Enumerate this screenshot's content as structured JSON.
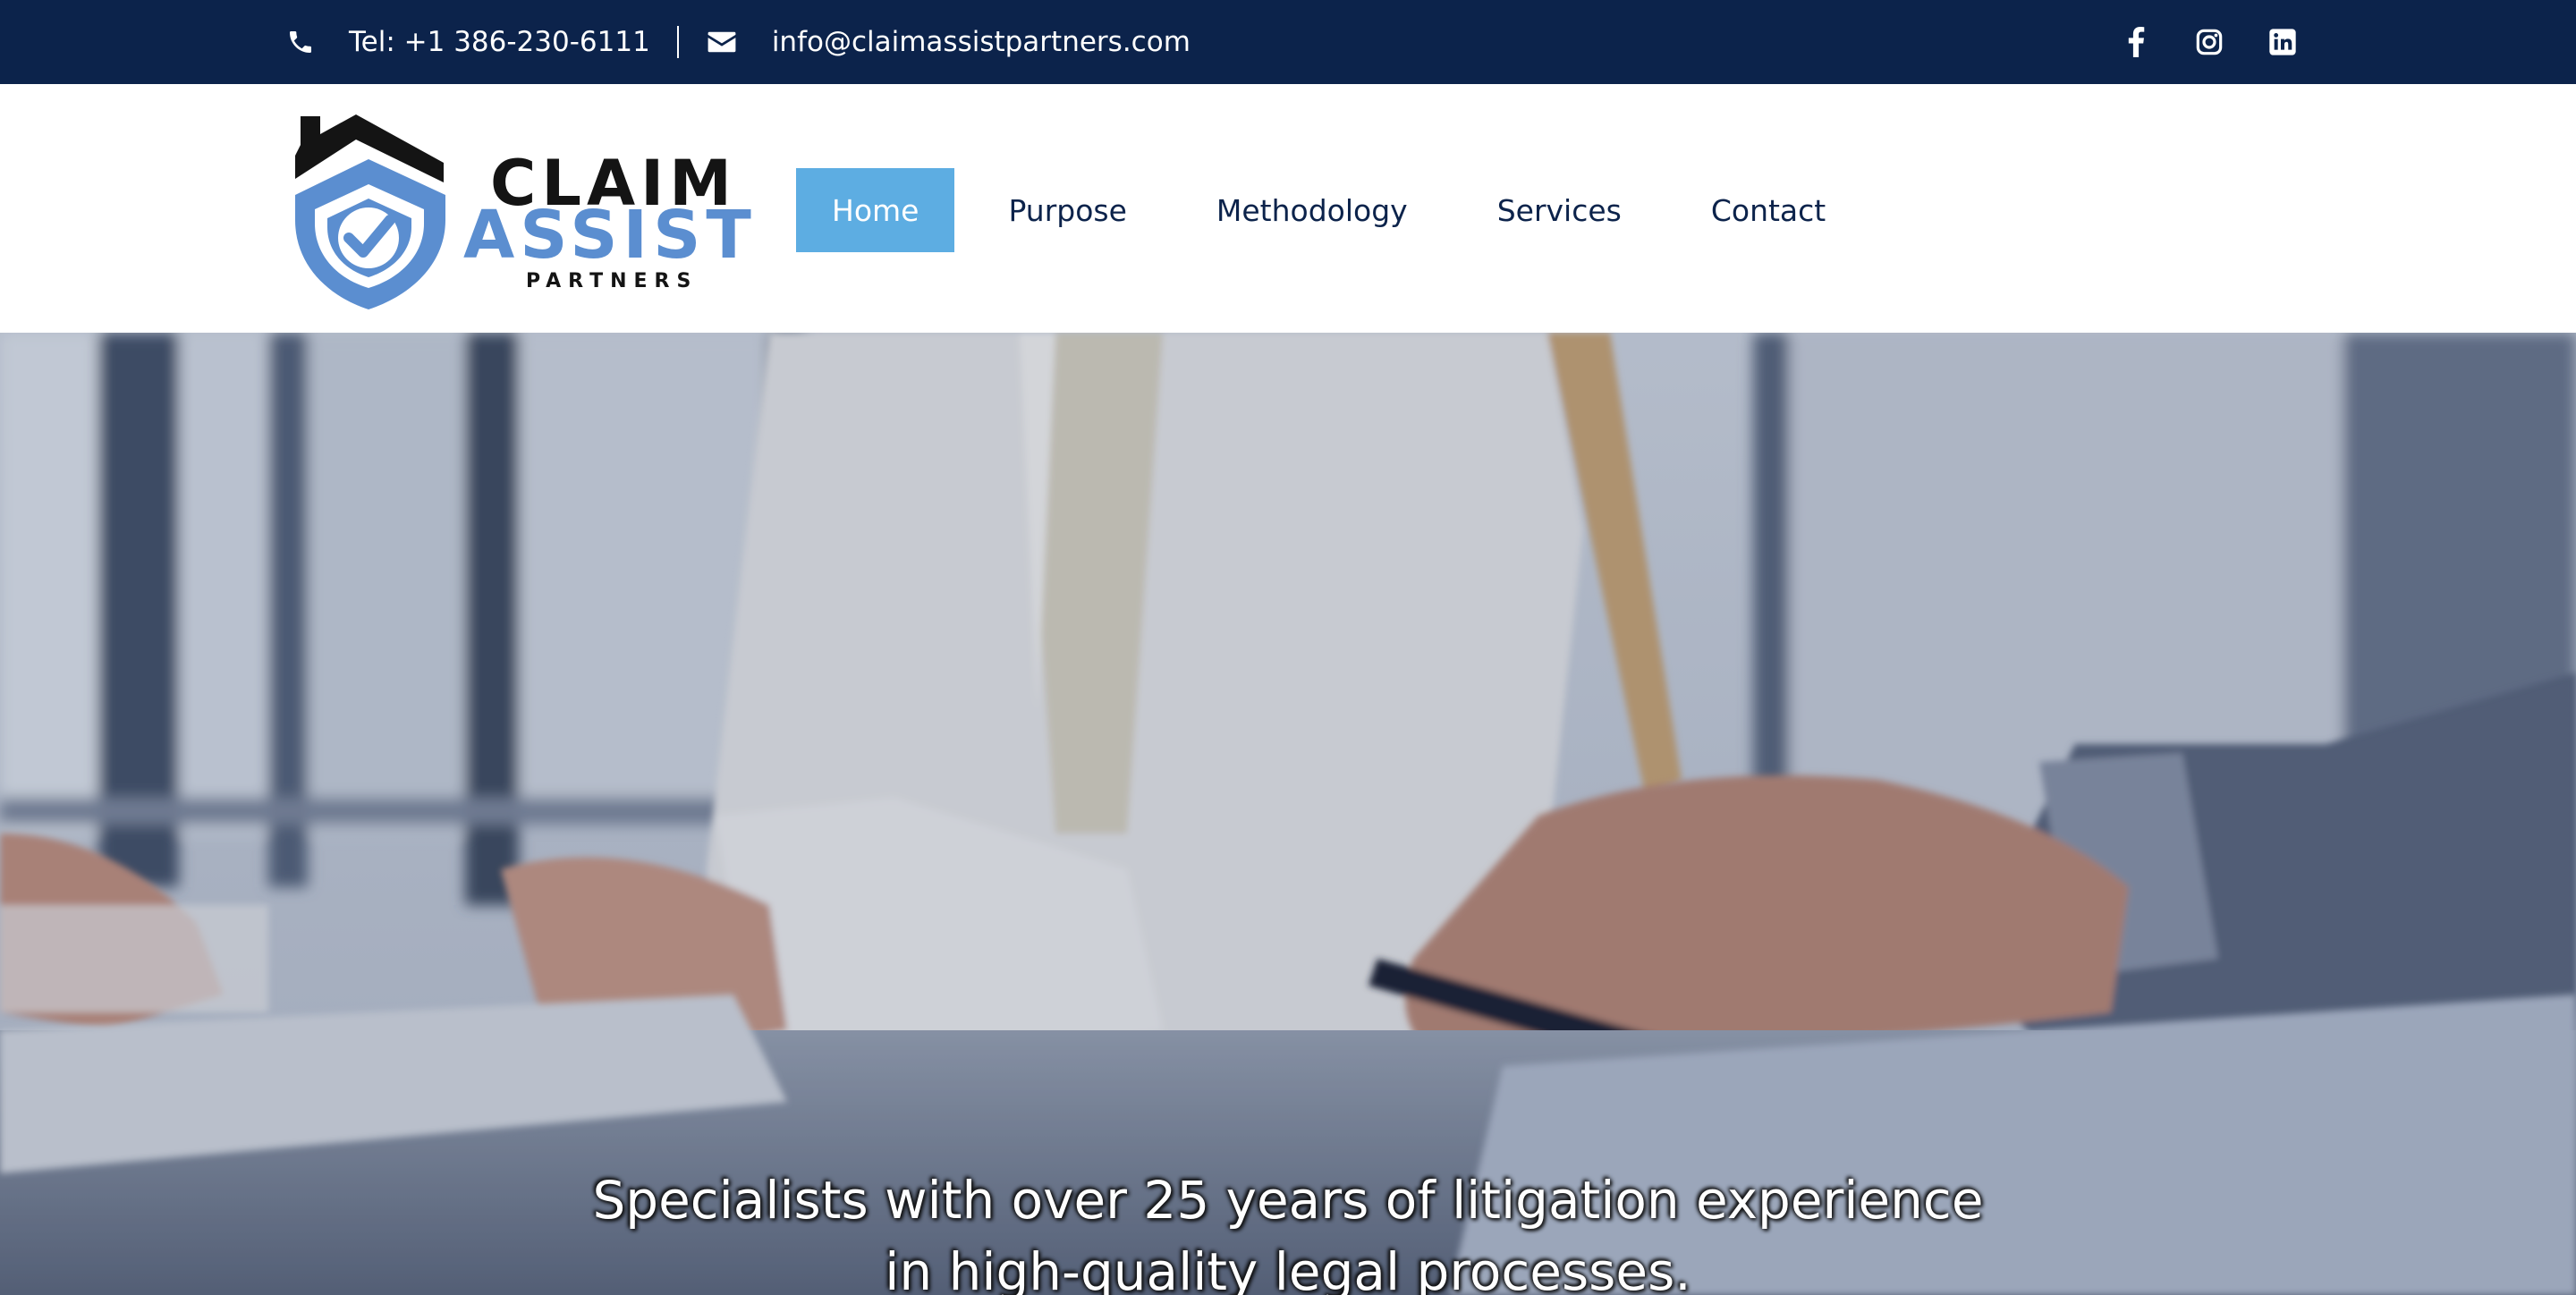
{
  "topbar": {
    "phone": "Tel: +1 386-230-6111",
    "email": "info@claimassistpartners.com",
    "phone_icon": "phone-icon",
    "email_icon": "envelope-icon",
    "social": [
      "facebook-icon",
      "instagram-icon",
      "linkedin-icon"
    ]
  },
  "logo": {
    "line1": "CLAIM",
    "line2": "ASSIST",
    "line3": "PARTNERS"
  },
  "nav": {
    "items": [
      {
        "label": "Home",
        "active": true
      },
      {
        "label": "Purpose",
        "active": false
      },
      {
        "label": "Methodology",
        "active": false
      },
      {
        "label": "Services",
        "active": false
      },
      {
        "label": "Contact",
        "active": false
      }
    ]
  },
  "hero": {
    "line1": "Specialists with over 25 years of litigation experience",
    "line2": "in high-quality legal processes."
  },
  "colors": {
    "topbar_bg": "#0c234b",
    "nav_active_bg": "#5dade2",
    "nav_text": "#0c234b",
    "logo_blue": "#5b8ed0"
  }
}
